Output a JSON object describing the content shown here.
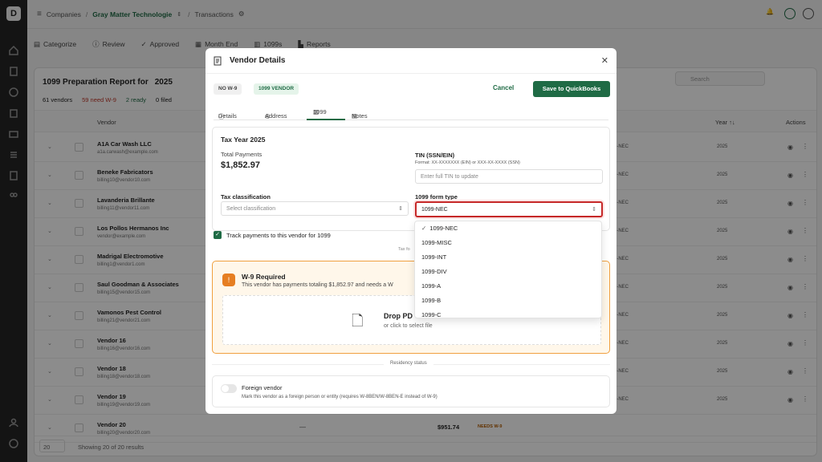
{
  "app": {
    "logo_letter": "D"
  },
  "topbar": {
    "crumbs": [
      "Companies",
      "Gray Matter Technologie",
      "Transactions"
    ],
    "separators": [
      "/",
      "/"
    ],
    "home_icon": "menu-icon"
  },
  "navtabs": [
    "Categorize",
    "Review",
    "Approved",
    "Month End",
    "1099s",
    "Reports"
  ],
  "report": {
    "title": "1099 Preparation Report for",
    "year": "2025",
    "stats": [
      "61 vendors",
      "59 need W-9",
      "2 ready",
      "0 filed"
    ],
    "search_placeholder": "Search",
    "columns": [
      "Vendor",
      "Year ↑↓",
      "Actions"
    ],
    "footer": {
      "page_size": "20",
      "showing": "Showing 20 of 20 results"
    }
  },
  "rows": [
    {
      "name": "A1A Car Wash LLC",
      "email": "a1a.carwash@example.com"
    },
    {
      "name": "Beneke Fabricators",
      "email": "billing10@vendor10.com"
    },
    {
      "name": "Lavanderia Brillante",
      "email": "billing11@vendor11.com"
    },
    {
      "name": "Los Pollos Hermanos Inc",
      "email": "vendor@example.com"
    },
    {
      "name": "Madrigal Electromotive",
      "email": "billing1@vendor1.com"
    },
    {
      "name": "Saul Goodman & Associates",
      "email": "billing15@vendor15.com"
    },
    {
      "name": "Vamonos Pest Control",
      "email": "billing21@vendor21.com"
    },
    {
      "name": "Vendor 16",
      "email": "billing16@vendor16.com"
    },
    {
      "name": "Vendor 18",
      "email": "billing18@vendor18.com"
    },
    {
      "name": "Vendor 19",
      "email": "billing19@vendor19.com"
    },
    {
      "name": "Vendor 20",
      "email": "billing20@vendor20.com"
    }
  ],
  "row_form_value": "-9-NEC",
  "row_year_value": "2025",
  "last_row": {
    "dash": "—",
    "amount": "$951.74",
    "status": "NEEDS W-9"
  },
  "modal": {
    "title": "Vendor Details",
    "badges": [
      "NO W-9",
      "1099 VENDOR"
    ],
    "cancel": "Cancel",
    "save": "Save to QuickBooks",
    "tabs": [
      "Details",
      "Address",
      "1099",
      "Notes"
    ],
    "active_tab": "1099",
    "tax_year": "Tax Year 2025",
    "total_payments_label": "Total Payments",
    "total_payments_value": "$1,852.97",
    "tin_label": "TIN (SSN/EIN)",
    "tin_hint": "Format: XX-XXXXXXX (EIN) or XXX-XX-XXXX (SSN)",
    "tin_placeholder": "Enter full TIN to update",
    "tax_class_label": "Tax classification",
    "tax_class_placeholder": "Select classification",
    "form_type_label": "1099 form type",
    "form_type_value": "1099-NEC",
    "track_label": "Track payments to this vendor for 1099",
    "tax_form_rule": "Tax fo",
    "w9_title": "W-9 Required",
    "w9_desc": "This vendor has payments totaling $1,852.97 and needs a W",
    "drop_title": "Drop PD",
    "drop_sub": "or click to select file",
    "residency": "Residency status",
    "foreign_label": "Foreign vendor",
    "foreign_desc": "Mark this vendor as a foreign person or entity (requires W-8BEN/W-8BEN-E instead of W-9)",
    "dropdown_options": [
      "1099-NEC",
      "1099-MISC",
      "1099-INT",
      "1099-DIV",
      "1099-A",
      "1099-B",
      "1099-C"
    ]
  },
  "colors": {
    "brand": "#1f6b45",
    "alert": "#c62828",
    "warning": "#e67e22"
  }
}
